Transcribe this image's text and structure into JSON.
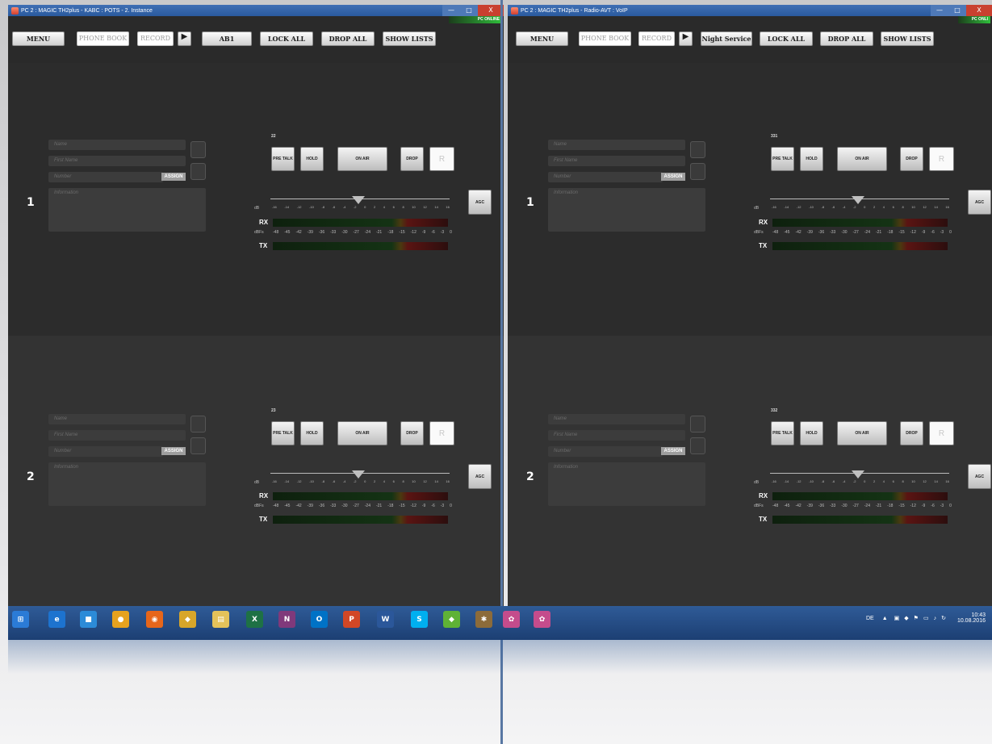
{
  "left_window": {
    "title": "PC 2 : MAGIC TH2plus - KABC : POTS - 2. Instance",
    "status": "PC ONLINE",
    "toolbar": {
      "menu": "MENU",
      "phone_book": "PHONE BOOK",
      "record": "RECORD",
      "play": "▶",
      "channel": "AB1",
      "lock_all": "LOCK ALL",
      "drop_all": "DROP ALL",
      "show_lists": "SHOW LISTS"
    },
    "lines": [
      {
        "number": "1",
        "id": "22"
      },
      {
        "number": "2",
        "id": "23"
      }
    ]
  },
  "right_window": {
    "title": "PC 2 : MAGIC TH2plus - Radio-AVT : VoIP",
    "status": "PC ONLI",
    "toolbar": {
      "menu": "MENU",
      "phone_book": "PHONE BOOK",
      "record": "RECORD",
      "play": "▶",
      "channel": "Night Service",
      "lock_all": "LOCK ALL",
      "drop_all": "DROP ALL",
      "show_lists": "SHOW LISTS"
    },
    "lines": [
      {
        "number": "1",
        "id": "331"
      },
      {
        "number": "2",
        "id": "332"
      }
    ]
  },
  "line_fields": {
    "name_placeholder": "Name",
    "first_name_placeholder": "First Name",
    "number_placeholder": "Number",
    "information_placeholder": "Information",
    "assign": "ASSIGN"
  },
  "controls": {
    "pre_talk": "PRE TALK",
    "hold": "HOLD",
    "on_air": "ON AIR",
    "drop": "DROP",
    "r": "R",
    "agc": "AGC",
    "rx": "RX",
    "tx": "TX",
    "db_label": "dB",
    "dbfs_label": "dBFs"
  },
  "fader_scale": [
    "-16",
    "-14",
    "-12",
    "-10",
    "-8",
    "-6",
    "-4",
    "-2",
    "0",
    "2",
    "4",
    "6",
    "8",
    "10",
    "12",
    "14",
    "16"
  ],
  "meter_scale": [
    "-48",
    "-45",
    "-42",
    "-39",
    "-36",
    "-33",
    "-30",
    "-27",
    "-24",
    "-21",
    "-18",
    "-15",
    "-12",
    "-9",
    "-6",
    "-3",
    "0"
  ],
  "window_controls": {
    "minimize": "—",
    "maximize": "□",
    "close": "X"
  },
  "taskbar": {
    "apps": [
      {
        "name": "start-icon",
        "glyph": "⊞",
        "color": "#2b7bd6"
      },
      {
        "name": "ie-icon",
        "glyph": "e",
        "color": "#1d73cf"
      },
      {
        "name": "app-icon",
        "glyph": "■",
        "color": "#2c8bd8"
      },
      {
        "name": "chrome-icon",
        "glyph": "●",
        "color": "#e6a21f"
      },
      {
        "name": "firefox-icon",
        "glyph": "◉",
        "color": "#e6661b"
      },
      {
        "name": "tool-icon",
        "glyph": "◆",
        "color": "#d8a62a"
      },
      {
        "name": "explorer-icon",
        "glyph": "▤",
        "color": "#e4c25a"
      },
      {
        "name": "excel-icon",
        "glyph": "X",
        "color": "#1e7145"
      },
      {
        "name": "onenote-icon",
        "glyph": "N",
        "color": "#80397b"
      },
      {
        "name": "outlook-icon",
        "glyph": "O",
        "color": "#0072c6"
      },
      {
        "name": "powerpoint-icon",
        "glyph": "P",
        "color": "#d24726"
      },
      {
        "name": "word-icon",
        "glyph": "W",
        "color": "#2b579a"
      },
      {
        "name": "skype-icon",
        "glyph": "S",
        "color": "#00aff0"
      },
      {
        "name": "app-green-icon",
        "glyph": "◆",
        "color": "#5fb236"
      },
      {
        "name": "app-tool-icon",
        "glyph": "✱",
        "color": "#8c6b3a"
      },
      {
        "name": "magic-icon-1",
        "glyph": "✿",
        "color": "#c44c8c"
      },
      {
        "name": "magic-icon-2",
        "glyph": "✿",
        "color": "#c44c8c"
      }
    ],
    "language": "DE",
    "time": "10:43",
    "date": "10.08.2016"
  }
}
